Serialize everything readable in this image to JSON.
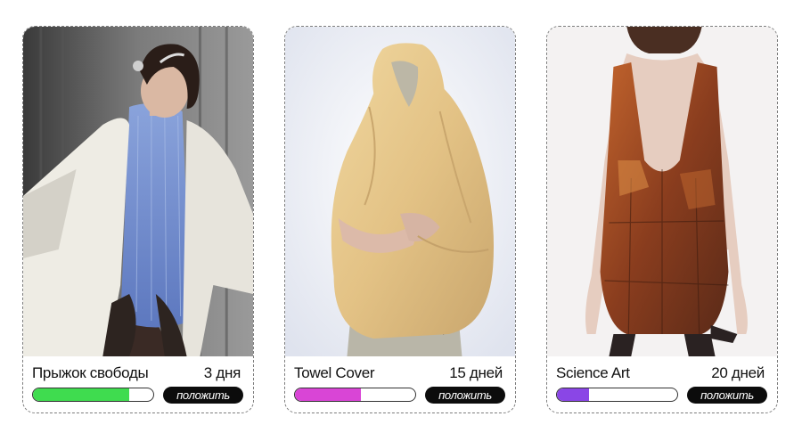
{
  "cards": [
    {
      "title": "Прыжок свободы",
      "days": "3 дня",
      "progress": 0.8,
      "progress_color": "#3fdc4f",
      "button_label": "положить",
      "image": "man-white-coat-blue-pleated-top"
    },
    {
      "title": "Towel Cover",
      "days": "15 дней",
      "progress": 0.55,
      "progress_color": "#d945d6",
      "button_label": "положить",
      "image": "figure-draped-yellow-towel"
    },
    {
      "title": "Science Art",
      "days": "20 дней",
      "progress": 0.27,
      "progress_color": "#8a46e6",
      "button_label": "положить",
      "image": "person-amber-leather-dress"
    }
  ]
}
